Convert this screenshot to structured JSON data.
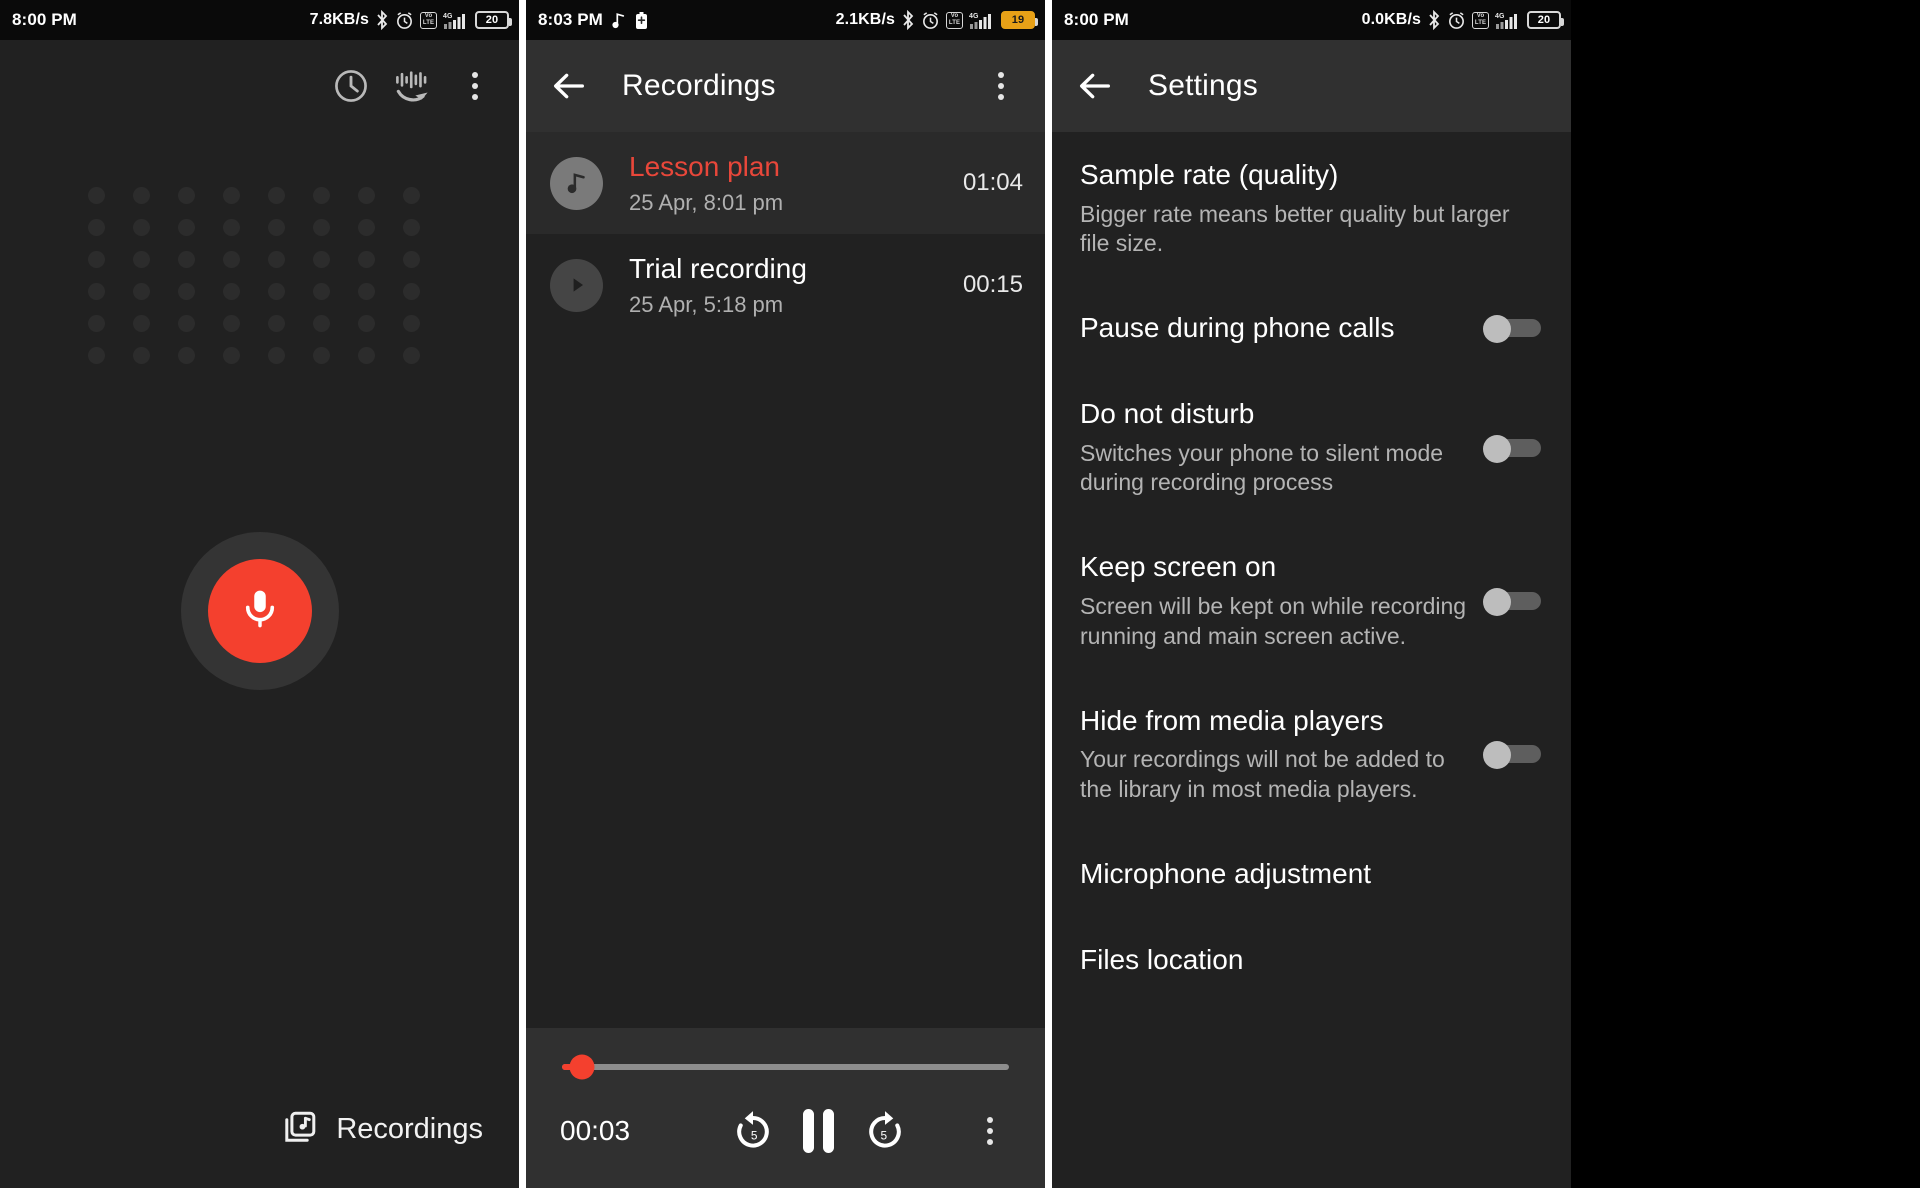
{
  "colors": {
    "accent": "#f4402e",
    "background": "#212121",
    "appbar": "#303030",
    "active_row": "#2a2a2a",
    "muted_text": "#b0b0b0"
  },
  "panel_recorder": {
    "status_bar": {
      "time": "8:00 PM",
      "net_speed": "7.8KB/s",
      "volte": "VoLTE",
      "network": "4G",
      "battery": "20"
    },
    "toolbar": {
      "history_label": "History",
      "import_label": "Import audio",
      "overflow_label": "More options"
    },
    "record_button_label": "Record",
    "recordings_link_label": "Recordings"
  },
  "panel_recordings": {
    "status_bar": {
      "time": "8:03 PM",
      "net_speed": "2.1KB/s",
      "volte": "VoLTE",
      "network": "4G",
      "battery": "19"
    },
    "title": "Recordings",
    "back_label": "Back",
    "overflow_label": "More options",
    "items": [
      {
        "name": "Lesson plan",
        "date": "25 Apr, 8:01 pm",
        "duration": "01:04",
        "state": "playing"
      },
      {
        "name": "Trial recording",
        "date": "25 Apr, 5:18 pm",
        "duration": "00:15",
        "state": "idle"
      }
    ],
    "player": {
      "current_time": "00:03",
      "progress_percent": 4.5,
      "rewind_label": "5",
      "forward_label": "5",
      "pause_label": "Pause",
      "overflow_label": "More options"
    }
  },
  "panel_settings": {
    "status_bar": {
      "time": "8:00 PM",
      "net_speed": "0.0KB/s",
      "volte": "VoLTE",
      "network": "4G",
      "battery": "20"
    },
    "title": "Settings",
    "back_label": "Back",
    "items": [
      {
        "title": "Sample rate (quality)",
        "desc": "Bigger rate means better quality but larger file size.",
        "toggle": null
      },
      {
        "title": "Pause during phone calls",
        "desc": "",
        "toggle": "off"
      },
      {
        "title": "Do not disturb",
        "desc": "Switches your phone to silent mode during recording process",
        "toggle": "off"
      },
      {
        "title": "Keep screen on",
        "desc": "Screen will be kept on while recording running and main screen active.",
        "toggle": "off"
      },
      {
        "title": "Hide from media players",
        "desc": "Your recordings will not be added to the library in most media players.",
        "toggle": "off"
      },
      {
        "title": "Microphone adjustment",
        "desc": "",
        "toggle": null
      },
      {
        "title": "Files location",
        "desc": "",
        "toggle": null
      }
    ]
  }
}
